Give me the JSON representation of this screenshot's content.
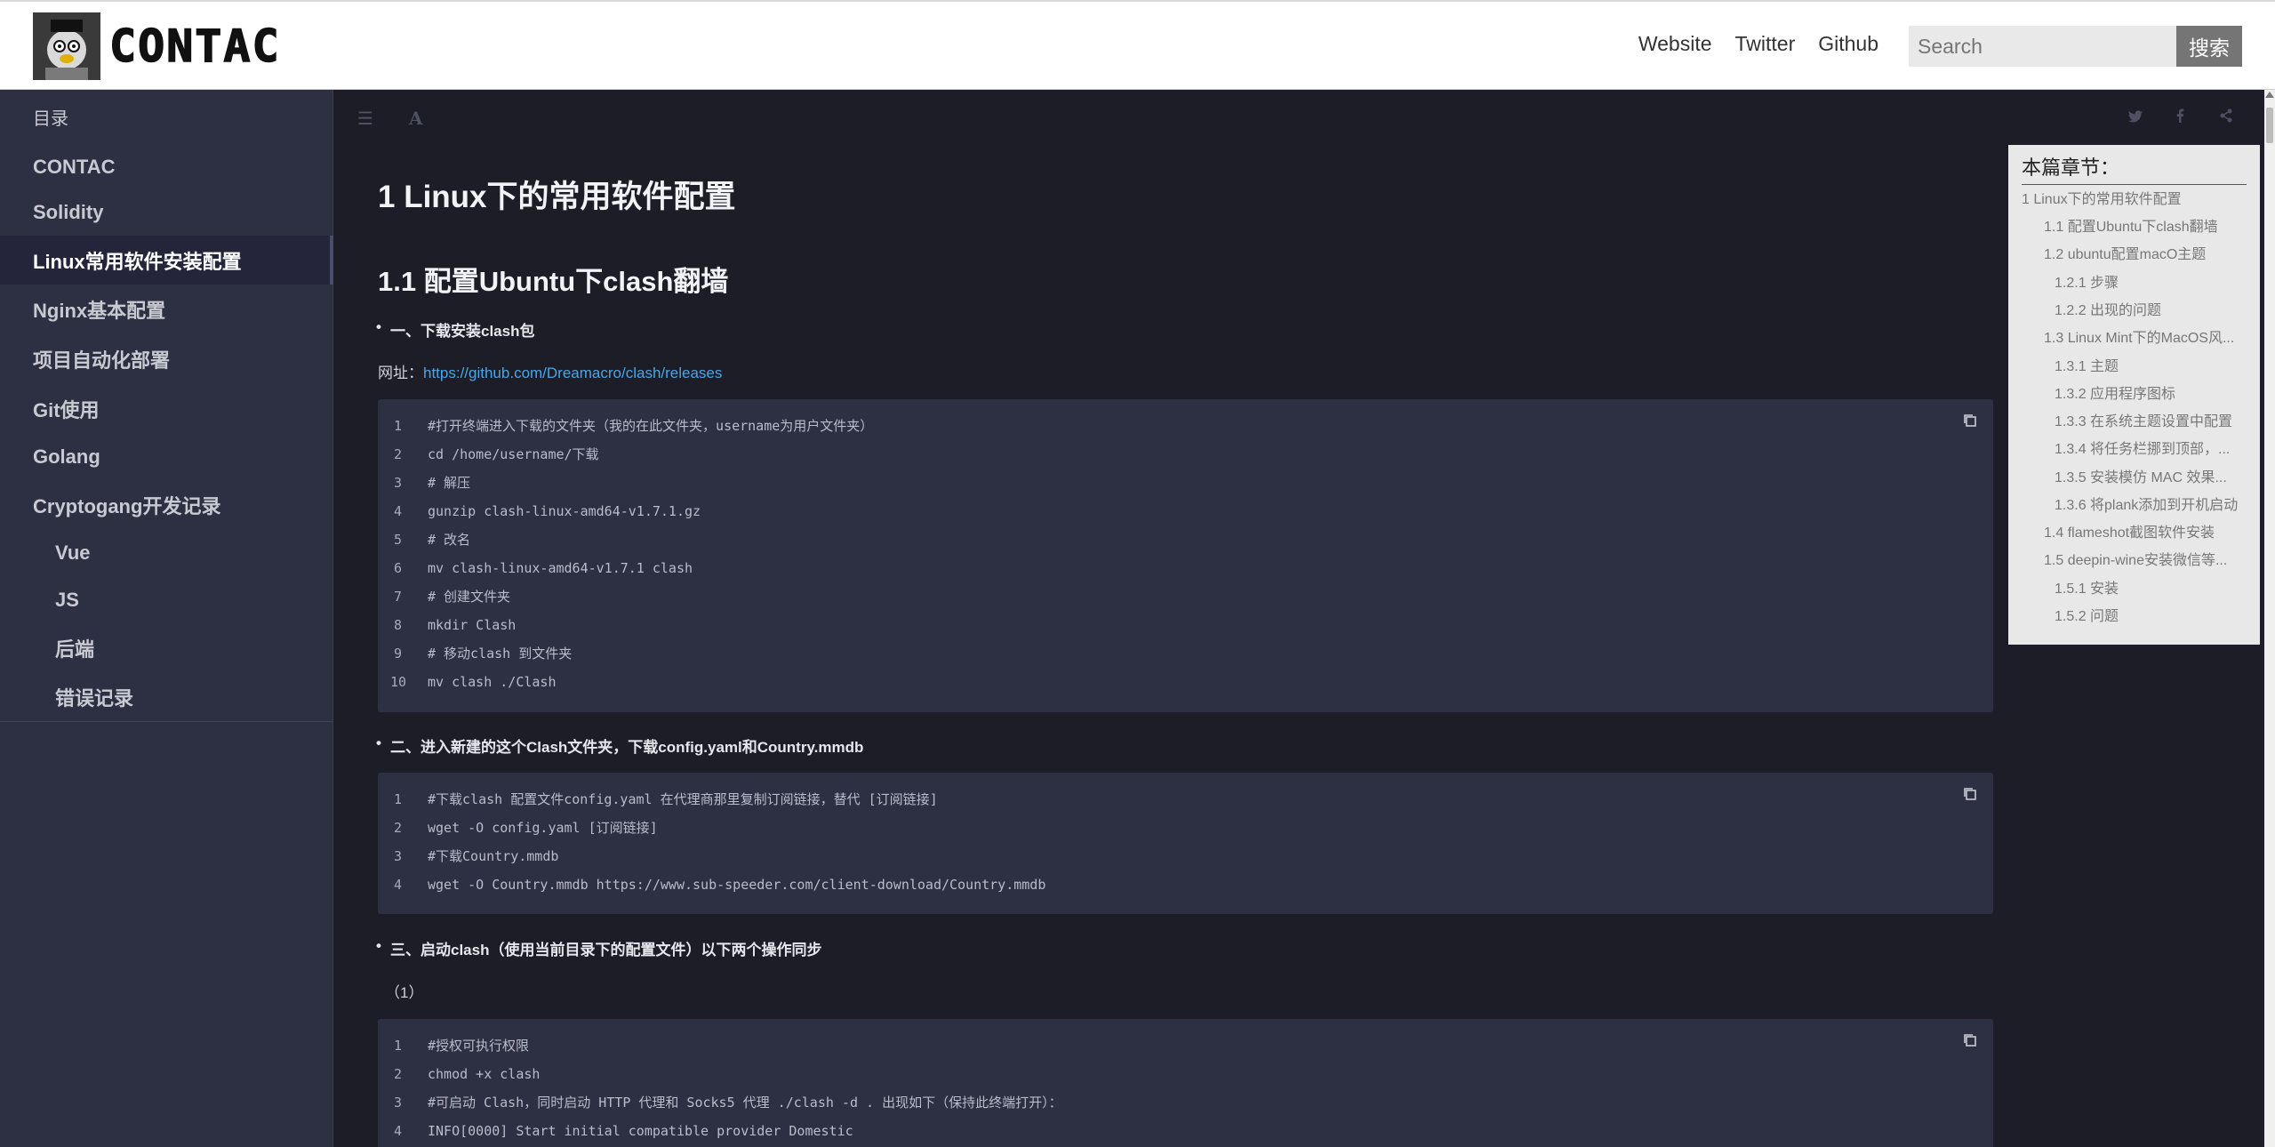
{
  "header": {
    "logo_text": "CONTAC",
    "nav": [
      "Website",
      "Twitter",
      "Github"
    ],
    "search_placeholder": "Search",
    "search_button": "搜索"
  },
  "sidebar": {
    "title": "目录",
    "items": [
      {
        "label": "CONTAC"
      },
      {
        "label": "Solidity"
      },
      {
        "label": "Linux常用软件安装配置"
      },
      {
        "label": "Nginx基本配置"
      },
      {
        "label": "项目自动化部署"
      },
      {
        "label": "Git使用"
      },
      {
        "label": "Golang"
      },
      {
        "label": "Cryptogang开发记录"
      },
      {
        "label": "Vue"
      },
      {
        "label": "JS"
      },
      {
        "label": "后端"
      },
      {
        "label": "错误记录"
      }
    ]
  },
  "toolbar": {
    "left_icons": [
      "menu-icon",
      "font-icon"
    ],
    "right_icons": [
      "twitter-icon",
      "facebook-icon",
      "share-icon"
    ]
  },
  "content": {
    "h1": "1 Linux下的常用软件配置",
    "h2": "1.1 配置Ubuntu下clash翻墙",
    "bullet1": "一、下载安装clash包",
    "url_label": "网址：",
    "url_link": "https://github.com/Dreamacro/clash/releases",
    "code1": [
      "#打开终端进入下载的文件夹（我的在此文件夹，username为用户文件夹）",
      "cd /home/username/下载",
      "# 解压",
      "gunzip clash-linux-amd64-v1.7.1.gz",
      "# 改名",
      "mv clash-linux-amd64-v1.7.1 clash",
      "# 创建文件夹",
      "mkdir Clash",
      "# 移动clash 到文件夹",
      "mv clash ./Clash"
    ],
    "bullet2": "二、进入新建的这个Clash文件夹，下载config.yaml和Country.mmdb",
    "code2": [
      "#下载clash 配置文件config.yaml 在代理商那里复制订阅链接，替代 [订阅链接]",
      "wget -O config.yaml [订阅链接]",
      "#下载Country.mmdb",
      "wget -O Country.mmdb https://www.sub-speeder.com/client-download/Country.mmdb"
    ],
    "bullet3": "三、启动clash（使用当前目录下的配置文件）以下两个操作同步",
    "para_step": "（1）",
    "code3": [
      "#授权可执行权限",
      "chmod +x clash",
      "#可启动 Clash，同时启动 HTTP 代理和 Socks5 代理 ./clash -d . 出现如下（保持此终端打开）：",
      "INFO[0000] Start initial compatible provider Domestic"
    ]
  },
  "toc": {
    "title": "本篇章节：",
    "items": [
      {
        "label": "1 Linux下的常用软件配置",
        "level": 1
      },
      {
        "label": "1.1 配置Ubuntu下clash翻墙",
        "level": 2
      },
      {
        "label": "1.2 ubuntu配置macO主题",
        "level": 2
      },
      {
        "label": "1.2.1 步骤",
        "level": 3
      },
      {
        "label": "1.2.2 出现的问题",
        "level": 3
      },
      {
        "label": "1.3 Linux Mint下的MacOS风...",
        "level": 2
      },
      {
        "label": "1.3.1 主题",
        "level": 3
      },
      {
        "label": "1.3.2 应用程序图标",
        "level": 3
      },
      {
        "label": "1.3.3 在系统主题设置中配置",
        "level": 3
      },
      {
        "label": "1.3.4 将任务栏挪到顶部，...",
        "level": 3
      },
      {
        "label": "1.3.5 安装模仿 MAC 效果...",
        "level": 3
      },
      {
        "label": "1.3.6 将plank添加到开机启动",
        "level": 3
      },
      {
        "label": "1.4 flameshot截图软件安装",
        "level": 2
      },
      {
        "label": "1.5 deepin-wine安装微信等...",
        "level": 2
      },
      {
        "label": "1.5.1 安装",
        "level": 3
      },
      {
        "label": "1.5.2 问题",
        "level": 3
      }
    ]
  },
  "colors": {
    "sidebar_bg": "#2d2f43",
    "content_bg": "#1c1d27",
    "code_bg": "#2d2f43",
    "link": "#4aa6e8",
    "toc_bg": "#e8e8e8"
  }
}
